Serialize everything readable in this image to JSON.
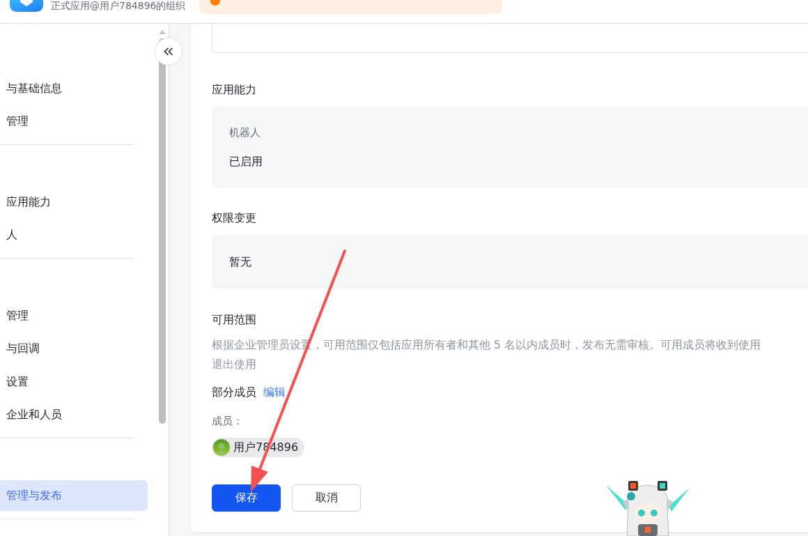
{
  "header": {
    "org_name": "正式应用@用户784896的组织"
  },
  "sidebar": {
    "sections": [
      {
        "items": [
          {
            "label": "与基础信息",
            "selected": false
          },
          {
            "label": "管理",
            "selected": false
          }
        ]
      },
      {
        "items": [
          {
            "label": "应用能力",
            "selected": false
          },
          {
            "label": "人",
            "selected": false
          }
        ]
      },
      {
        "items": [
          {
            "label": "管理",
            "selected": false
          },
          {
            "label": "与回调",
            "selected": false
          },
          {
            "label": "设置",
            "selected": false
          },
          {
            "label": "企业和人员",
            "selected": false
          }
        ]
      },
      {
        "items": [
          {
            "label": "管理与发布",
            "selected": true
          }
        ]
      }
    ]
  },
  "capabilities": {
    "title": "应用能力",
    "items": [
      {
        "label": "机器人",
        "value": "已启用"
      }
    ]
  },
  "permission_changes": {
    "title": "权限变更",
    "value": "暂无"
  },
  "availability": {
    "title": "可用范围",
    "description": [
      "根据企业管理员设置，可用范围仅包括应用所有者和其他 5 名以内成员时，发布无需审核。可用成员将收到使用",
      "退出使用"
    ],
    "scope": "部分成员",
    "edit_link": "编辑",
    "members_label": "成员：",
    "members": [
      {
        "name": "用户784896"
      }
    ]
  },
  "buttons": [
    {
      "label": "保存",
      "kind": "primary"
    },
    {
      "label": "取消",
      "kind": "default"
    }
  ]
}
